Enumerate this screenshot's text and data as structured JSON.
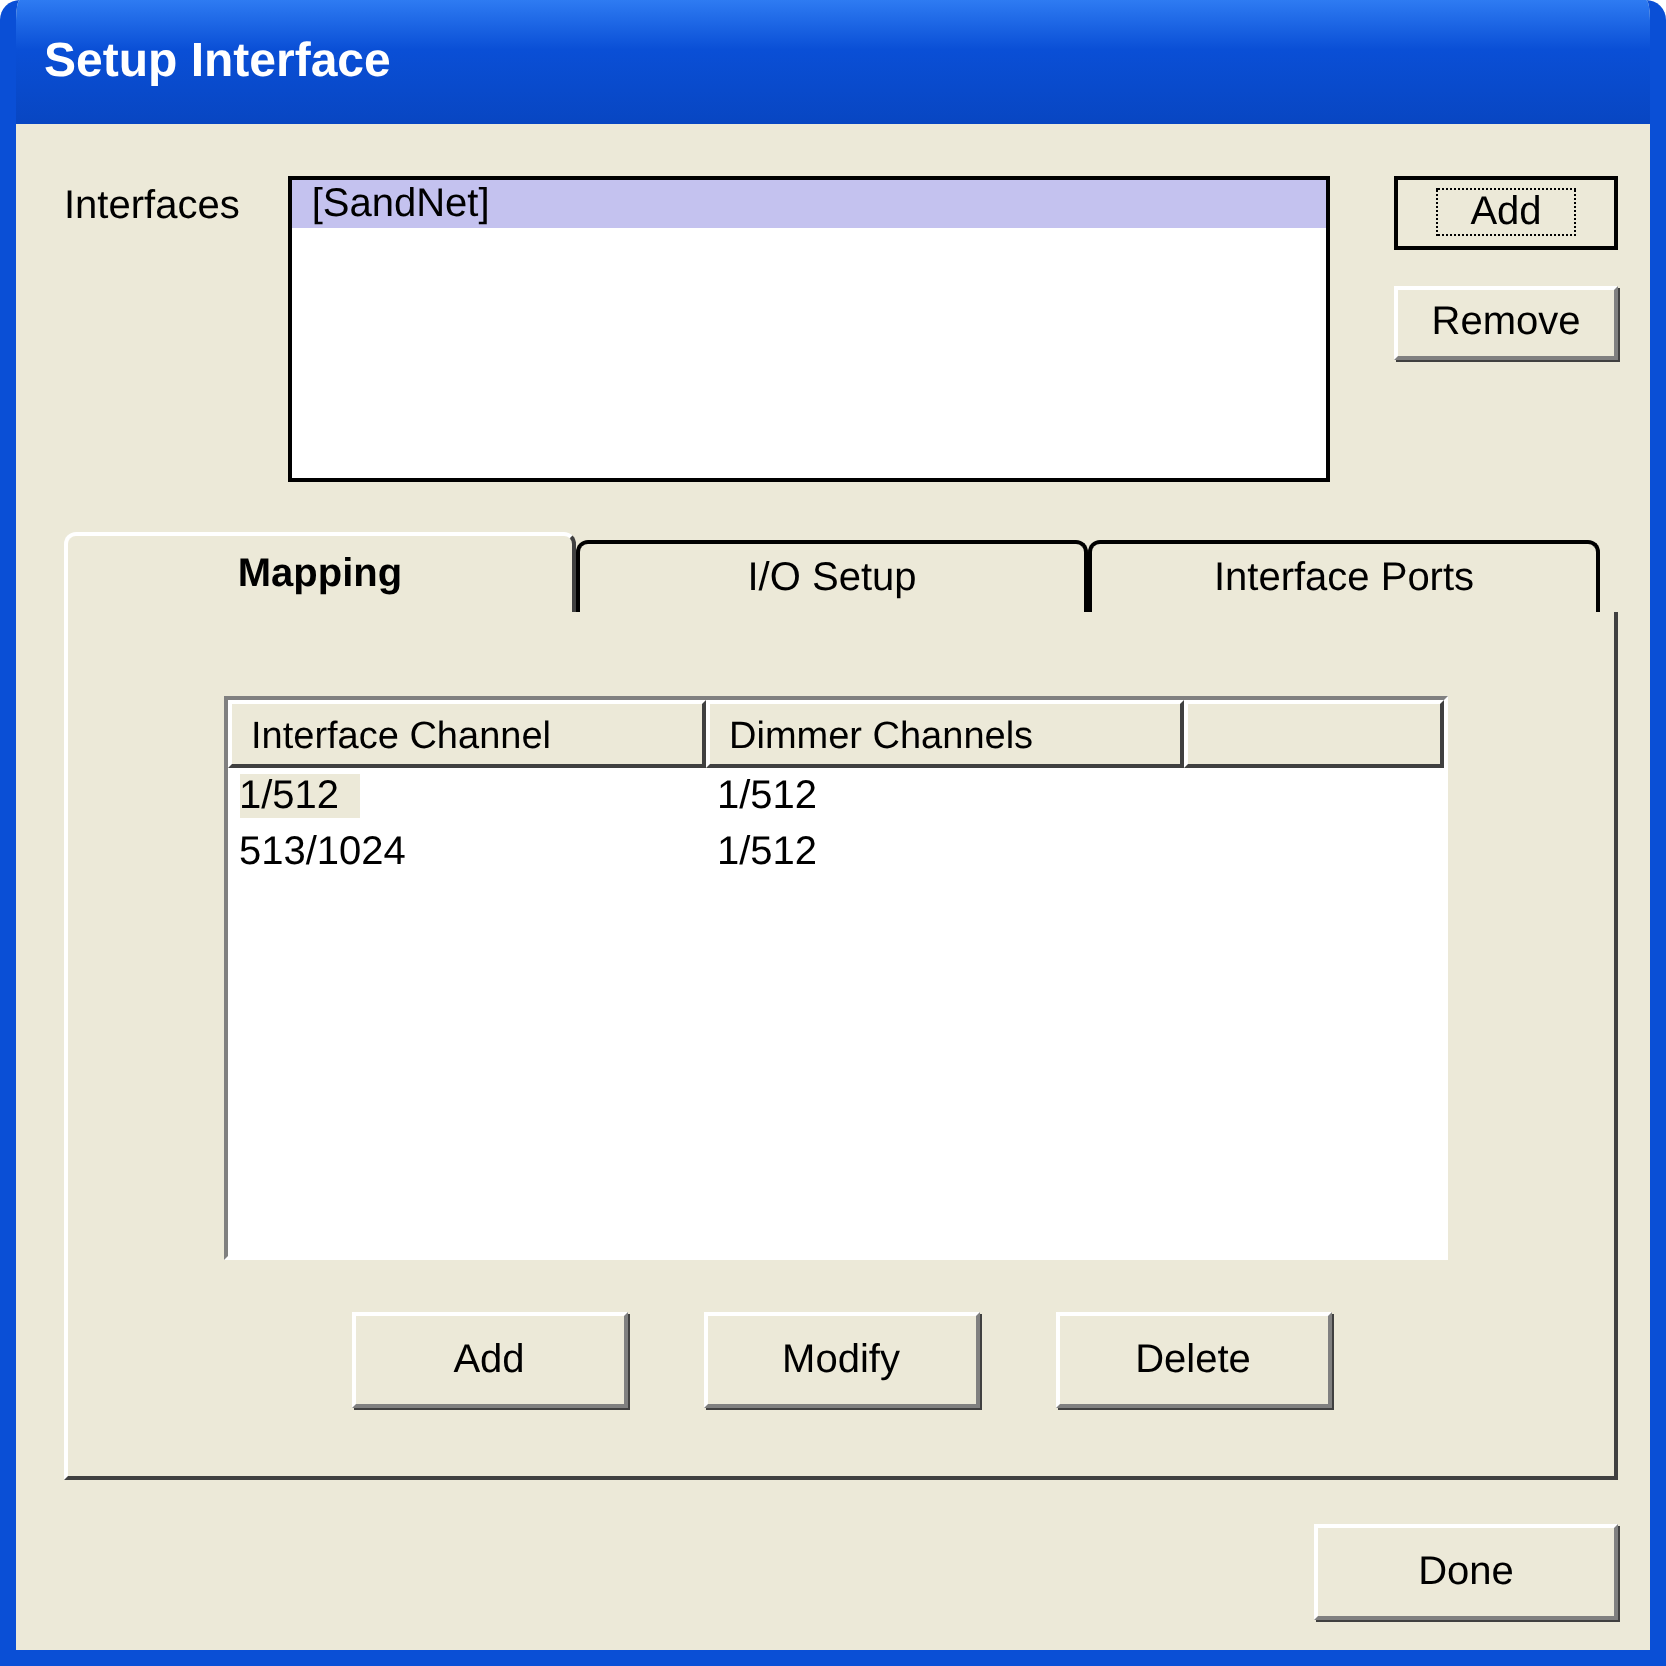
{
  "window": {
    "title": "Setup Interface"
  },
  "interfaces": {
    "label": "Interfaces",
    "items": [
      {
        "text": "[SandNet]",
        "selected": true
      }
    ]
  },
  "side_buttons": [
    {
      "label": "Add",
      "focused": true
    },
    {
      "label": "Remove",
      "focused": false
    }
  ],
  "tabs": [
    {
      "label": "Mapping",
      "selected": true
    },
    {
      "label": "I/O Setup",
      "selected": false
    },
    {
      "label": "Interface Ports",
      "selected": false
    }
  ],
  "table": {
    "columns": [
      "Interface Channel",
      "Dimmer Channels"
    ],
    "rows": [
      {
        "cells": [
          "1/512",
          "1/512"
        ],
        "selected": true
      },
      {
        "cells": [
          "513/1024",
          "1/512"
        ],
        "selected": false
      }
    ]
  },
  "table_buttons": [
    "Add",
    "Modify",
    "Delete"
  ],
  "done_button": "Done"
}
